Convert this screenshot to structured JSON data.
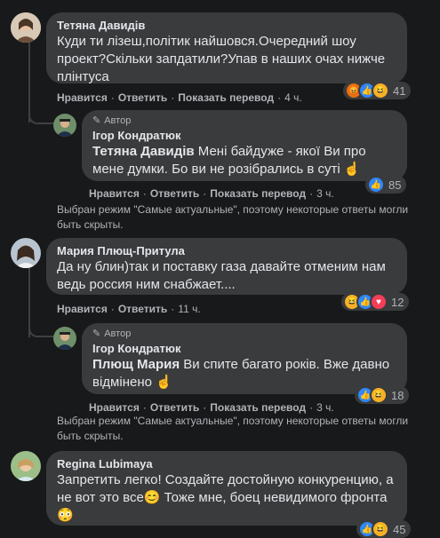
{
  "comments": [
    {
      "name": "Тетяна Давидів",
      "text": "Куди ти лізеш,політик найшовся.Очередний шоу проект?Скільки запдатили?Упав в наших очах нижче плінтуса",
      "actions": {
        "like": "Нравится",
        "reply": "Ответить",
        "translate": "Показать перевод",
        "time": "4 ч."
      },
      "reactions": {
        "count": "41",
        "icons": [
          "angry-icon",
          "like-icon",
          "haha-icon"
        ]
      }
    },
    {
      "author_badge": "Автор",
      "name": "Ігор Кондратюк",
      "mention": "Тетяна Давидів",
      "text": "Мені байдуже - якої Ви про мене думки. Бо ви не розібрались в суті ☝",
      "actions": {
        "like": "Нравится",
        "reply": "Ответить",
        "translate": "Показать перевод",
        "time": "3 ч."
      },
      "reactions": {
        "count": "85",
        "icons": [
          "like-icon"
        ]
      }
    },
    {
      "name": "Мария Плющ-Притула",
      "text": "Да ну блин)так и поставку газа давайте отменим нам ведь россия ним снабжает....",
      "actions": {
        "like": "Нравится",
        "reply": "Ответить",
        "time": "11 ч."
      },
      "reactions": {
        "count": "12",
        "icons": [
          "haha-icon",
          "like-icon",
          "love-icon"
        ]
      }
    },
    {
      "author_badge": "Автор",
      "name": "Ігор Кондратюк",
      "mention": "Плющ Мария",
      "text": "Ви спите багато років. Вже давно відмінено ☝",
      "actions": {
        "like": "Нравится",
        "reply": "Ответить",
        "translate": "Показать перевод",
        "time": "3 ч."
      },
      "reactions": {
        "count": "18",
        "icons": [
          "like-icon",
          "haha-icon"
        ]
      }
    },
    {
      "name": "Regina Lubimaya",
      "text": "Запретить легко! Создайте достойную конкуренцию, а не вот это все😊 Тоже мне, боец невидимого фронта 😳",
      "reactions": {
        "count": "45",
        "icons": [
          "like-icon",
          "haha-icon"
        ]
      }
    }
  ],
  "notes": {
    "first": "Выбран режим \"Самые актуальные\", поэтому некоторые ответы могли быть скрыты.",
    "second": "Выбран режим \"Самые актуальные\", поэтому некоторые ответы могли быть скрыты."
  },
  "colors": {
    "background": "#18191a",
    "bubble": "#3a3b3c",
    "text": "#e4e6eb",
    "muted": "#b0b3b8",
    "like": "#2d88ff",
    "angry": "#e9710f",
    "haha": "#f7b125",
    "love": "#f33e58"
  }
}
